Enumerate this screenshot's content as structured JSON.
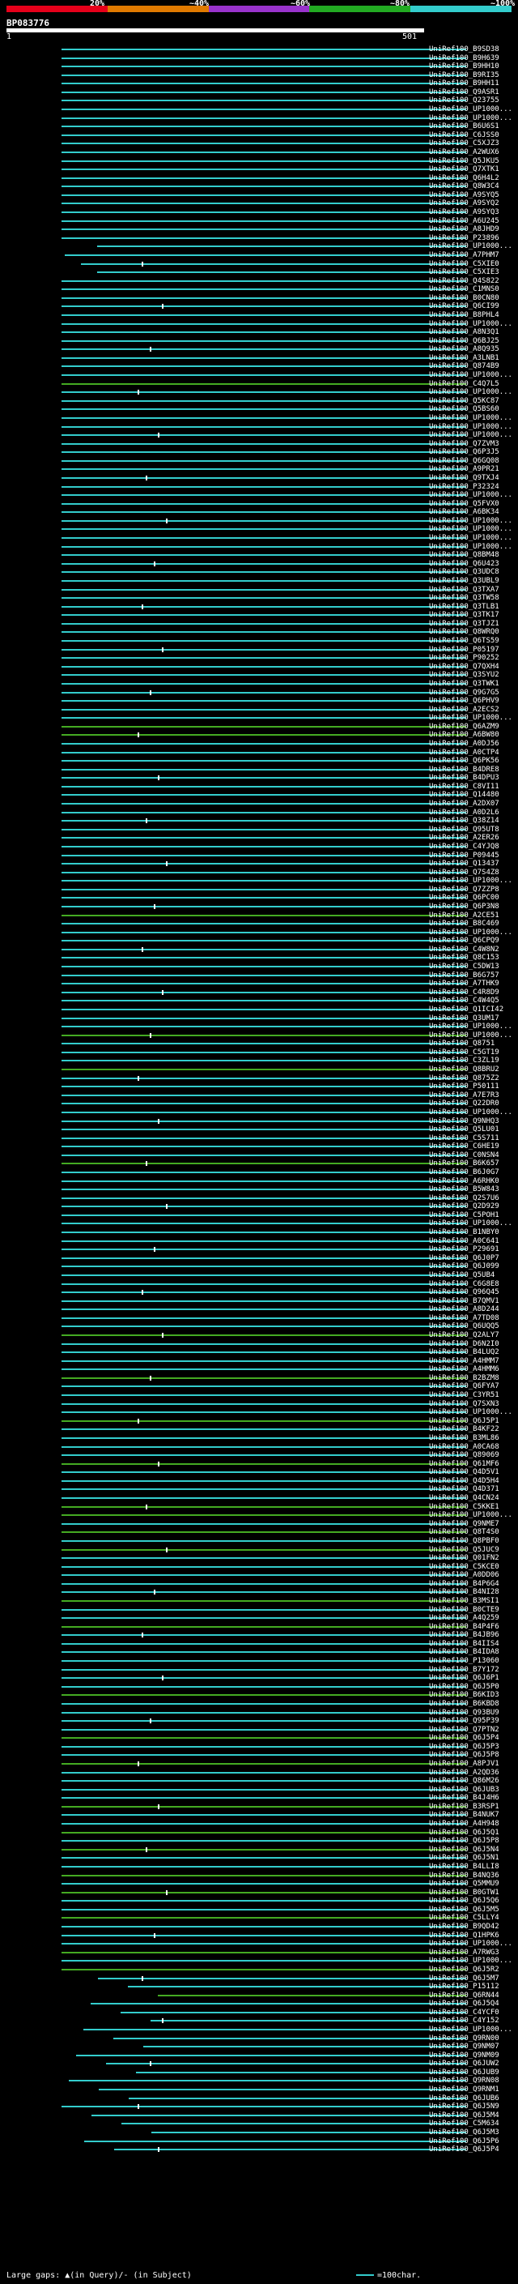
{
  "legend": {
    "segments": [
      "#e6001a",
      "#e07a00",
      "#9933cc",
      "#22aa22",
      "#33cccc"
    ],
    "labels": [
      "20%",
      "~40%",
      "~60%",
      "~80%",
      "~100%"
    ]
  },
  "query": {
    "id": "BP083776",
    "start": "1",
    "end": "501"
  },
  "hit_colors": {
    "cyan": "#33cccc",
    "green": "#44aa22"
  },
  "hits": [
    "UniRef100_B9SD38",
    "UniRef100_B9H639",
    "UniRef100_B9HH10",
    "UniRef100_B9RI35",
    "UniRef100_B9HH11",
    "UniRef100_Q9ASR1",
    "UniRef100_Q23755",
    "UniRef100_UP1000...",
    "UniRef100_UP1000...",
    "UniRef100_B6U6S1",
    "UniRef100_C6JSS0",
    "UniRef100_C5XJZ3",
    "UniRef100_A2WUX6",
    "UniRef100_Q5JKU5",
    "UniRef100_Q7XTK1",
    "UniRef100_Q6H4L2",
    "UniRef100_Q8W3C4",
    "UniRef100_A9SYQ5",
    "UniRef100_A9SYQ2",
    "UniRef100_A9SYQ3",
    "UniRef100_A6U245",
    "UniRef100_A8JHD9",
    "UniRef100_P23896",
    "UniRef100_UP1000...",
    "UniRef100_A7PHM7",
    "UniRef100_C5XIE0",
    "UniRef100_C5XIE3",
    "UniRef100_Q4S822",
    "UniRef100_C1MNS0",
    "UniRef100_B0CN80",
    "UniRef100_Q6CI99",
    "UniRef100_B8PHL4",
    "UniRef100_UP1000...",
    "UniRef100_A8N3Q1",
    "UniRef100_Q6BJ25",
    "UniRef100_A8Q935",
    "UniRef100_A3LNB1",
    "UniRef100_Q874B9",
    "UniRef100_UP1000...",
    "UniRef100_C4Q7L5",
    "UniRef100_UP1000...",
    "UniRef100_Q5KC87",
    "UniRef100_Q5BS60",
    "UniRef100_UP1000...",
    "UniRef100_UP1000...",
    "UniRef100_UP1000...",
    "UniRef100_Q7ZVM3",
    "UniRef100_Q6P3J5",
    "UniRef100_Q6GQ08",
    "UniRef100_A9PR21",
    "UniRef100_Q9TXJ4",
    "UniRef100_P32324",
    "UniRef100_UP1000...",
    "UniRef100_Q5FVX0",
    "UniRef100_A6BK34",
    "UniRef100_UP1000...",
    "UniRef100_UP1000...",
    "UniRef100_UP1000...",
    "UniRef100_UP1000...",
    "UniRef100_Q8BM48",
    "UniRef100_Q6U423",
    "UniRef100_Q3UDC8",
    "UniRef100_Q3UBL9",
    "UniRef100_Q3TXA7",
    "UniRef100_Q3TW58",
    "UniRef100_Q3TLB1",
    "UniRef100_Q3TK17",
    "UniRef100_Q3TJZ1",
    "UniRef100_Q8WRQ0",
    "UniRef100_Q6TS59",
    "UniRef100_P05197",
    "UniRef100_P90252",
    "UniRef100_Q7QXH4",
    "UniRef100_Q3SYU2",
    "UniRef100_Q3TWK1",
    "UniRef100_Q9G7G5",
    "UniRef100_Q6PHV9",
    "UniRef100_A2ECS2",
    "UniRef100_UP1000...",
    "UniRef100_Q6AZM9",
    "UniRef100_A6BW80",
    "UniRef100_A0DJ56",
    "UniRef100_A0CTP4",
    "UniRef100_Q6PK56",
    "UniRef100_B4DRE8",
    "UniRef100_B4DPU3",
    "UniRef100_C8VI11",
    "UniRef100_Q14480",
    "UniRef100_A2DX07",
    "UniRef100_A0D2L6",
    "UniRef100_Q38Z14",
    "UniRef100_Q95UT8",
    "UniRef100_A2ER26",
    "UniRef100_C4YJQ8",
    "UniRef100_P09445",
    "UniRef100_Q13437",
    "UniRef100_Q7S4Z8",
    "UniRef100_UP1000...",
    "UniRef100_Q7ZZP8",
    "UniRef100_Q6PC00",
    "UniRef100_Q6P3N8",
    "UniRef100_A2CE51",
    "UniRef100_B8C469",
    "UniRef100_UP1000...",
    "UniRef100_Q6CPQ9",
    "UniRef100_C4W8N2",
    "UniRef100_Q8C153",
    "UniRef100_C5DW13",
    "UniRef100_B6G757",
    "UniRef100_A7THK9",
    "UniRef100_C4R8D9",
    "UniRef100_C4W4Q5",
    "UniRef100_Q1ICI42",
    "UniRef100_Q3UM17",
    "UniRef100_UP1000...",
    "UniRef100_UP1000...",
    "UniRef100_Q8751",
    "UniRef100_C5GT19",
    "UniRef100_C3ZL19",
    "UniRef100_Q8BRU2",
    "UniRef100_Q875Z2",
    "UniRef100_P50111",
    "UniRef100_A7E7R3",
    "UniRef100_Q22DR0",
    "UniRef100_UP1000...",
    "UniRef100_Q9NHQ3",
    "UniRef100_Q5LU01",
    "UniRef100_C5S711",
    "UniRef100_C6HE19",
    "UniRef100_C0NSN4",
    "UniRef100_B6K657",
    "UniRef100_B6J0G7",
    "UniRef100_A6RHK0",
    "UniRef100_B5W843",
    "UniRef100_Q2S7U6",
    "UniRef100_Q2D929",
    "UniRef100_C5POH1",
    "UniRef100_UP1000...",
    "UniRef100_B1NBY0",
    "UniRef100_A0C641",
    "UniRef100_P29691",
    "UniRef100_Q6J0P7",
    "UniRef100_Q6J099",
    "UniRef100_Q5UB4",
    "UniRef100_C6G8E8",
    "UniRef100_Q96Q45",
    "UniRef100_B7QMV1",
    "UniRef100_A8D244",
    "UniRef100_A7TD08",
    "UniRef100_Q6UQQ5",
    "UniRef100_Q2ALY7",
    "UniRef100_D6N2I0",
    "UniRef100_B4LUQ2",
    "UniRef100_A4HMM7",
    "UniRef100_A4HMM6",
    "UniRef100_B2BZM8",
    "UniRef100_Q6FYA7",
    "UniRef100_C3YR51",
    "UniRef100_Q7SXN3",
    "UniRef100_UP1000...",
    "UniRef100_Q6J5P1",
    "UniRef100_B4KF22",
    "UniRef100_B3ML86",
    "UniRef100_A0CA68",
    "UniRef100_Q89069",
    "UniRef100_Q61MF6",
    "UniRef100_Q4D5V1",
    "UniRef100_Q4D5H4",
    "UniRef100_Q4D371",
    "UniRef100_Q4CN24",
    "UniRef100_C5KKE1",
    "UniRef100_UP1000...",
    "UniRef100_Q9NME7",
    "UniRef100_Q8T4S0",
    "UniRef100_Q8PBF0",
    "UniRef100_Q5JUC9",
    "UniRef100_Q01FN2",
    "UniRef100_C5KCE0",
    "UniRef100_A0DD06",
    "UniRef100_B4P6G4",
    "UniRef100_B4NI28",
    "UniRef100_B3MSI1",
    "UniRef100_B0CTE9",
    "UniRef100_A4Q259",
    "UniRef100_B4P4F6",
    "UniRef100_B4JB96",
    "UniRef100_B4IIS4",
    "UniRef100_B4IDA8",
    "UniRef100_P13060",
    "UniRef100_B7Y172",
    "UniRef100_Q6J6P1",
    "UniRef100_Q6J5P0",
    "UniRef100_B6KID3",
    "UniRef100_B6KBD8",
    "UniRef100_Q93BU9",
    "UniRef100_Q95P39",
    "UniRef100_Q7PTN2",
    "UniRef100_Q6J5P4",
    "UniRef100_Q6J5P3",
    "UniRef100_Q6J5P8",
    "UniRef100_A8PJV1",
    "UniRef100_A2QD36",
    "UniRef100_Q86M26",
    "UniRef100_Q6JUB3",
    "UniRef100_B4J4H6",
    "UniRef100_B3RSP1",
    "UniRef100_B4NUK7",
    "UniRef100_A4H948",
    "UniRef100_Q6J5Q1",
    "UniRef100_Q6J5P8",
    "UniRef100_Q6J5N4",
    "UniRef100_Q6J5N1",
    "UniRef100_B4LLI8",
    "UniRef100_B4NQ36",
    "UniRef100_Q5MMU9",
    "UniRef100_B0GTW1",
    "UniRef100_Q6J5Q6",
    "UniRef100_Q6J5M5",
    "UniRef100_C5LLY4",
    "UniRef100_B9QD42",
    "UniRef100_Q1HPK6",
    "UniRef100_UP1000...",
    "UniRef100_A7RWG3",
    "UniRef100_UP1000...",
    "UniRef100_Q6J5R2",
    "UniRef100_Q6J5M7",
    "UniRef100_P15112",
    "UniRef100_Q6RN44",
    "UniRef100_Q6J5Q4",
    "UniRef100_C4YCF0",
    "UniRef100_C4Y152",
    "UniRef100_UP1000...",
    "UniRef100_Q9RN00",
    "UniRef100_Q9NM07",
    "UniRef100_Q9NM09",
    "UniRef100_Q6JUW2",
    "UniRef100_Q6JUB9",
    "UniRef100_Q9RN08",
    "UniRef100_Q9RNM1",
    "UniRef100_Q6JUB6",
    "UniRef100_Q6J5N9",
    "UniRef100_Q6J5M4",
    "UniRef100_C5M634",
    "UniRef100_Q6J5M3",
    "UniRef100_Q6J5P6",
    "UniRef100_Q6J5P4"
  ],
  "footer": {
    "large_gaps": "Large gaps: ▲(in Query)/- (in Subject)",
    "scale_note": "=100char."
  }
}
